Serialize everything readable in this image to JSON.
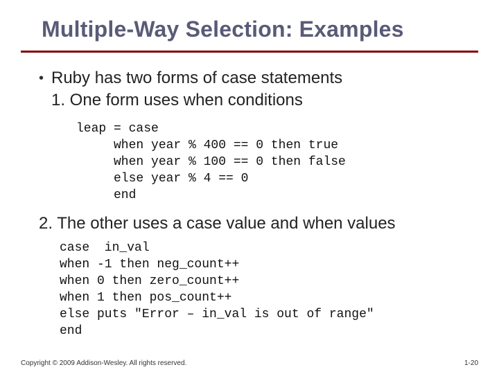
{
  "title": "Multiple-Way Selection: Examples",
  "bullet": "Ruby has two forms of case statements",
  "sub1": "1. One form uses when conditions",
  "code1": "leap = case\n     when year % 400 == 0 then true\n     when year % 100 == 0 then false\n     else year % 4 == 0\n     end",
  "sub2": "2. The other uses a case value and when values",
  "code2": "case  in_val\nwhen -1 then neg_count++\nwhen 0 then zero_count++\nwhen 1 then pos_count++\nelse puts \"Error – in_val is out of range\"\nend",
  "footer_left": "Copyright © 2009 Addison-Wesley. All rights reserved.",
  "footer_right": "1-20"
}
